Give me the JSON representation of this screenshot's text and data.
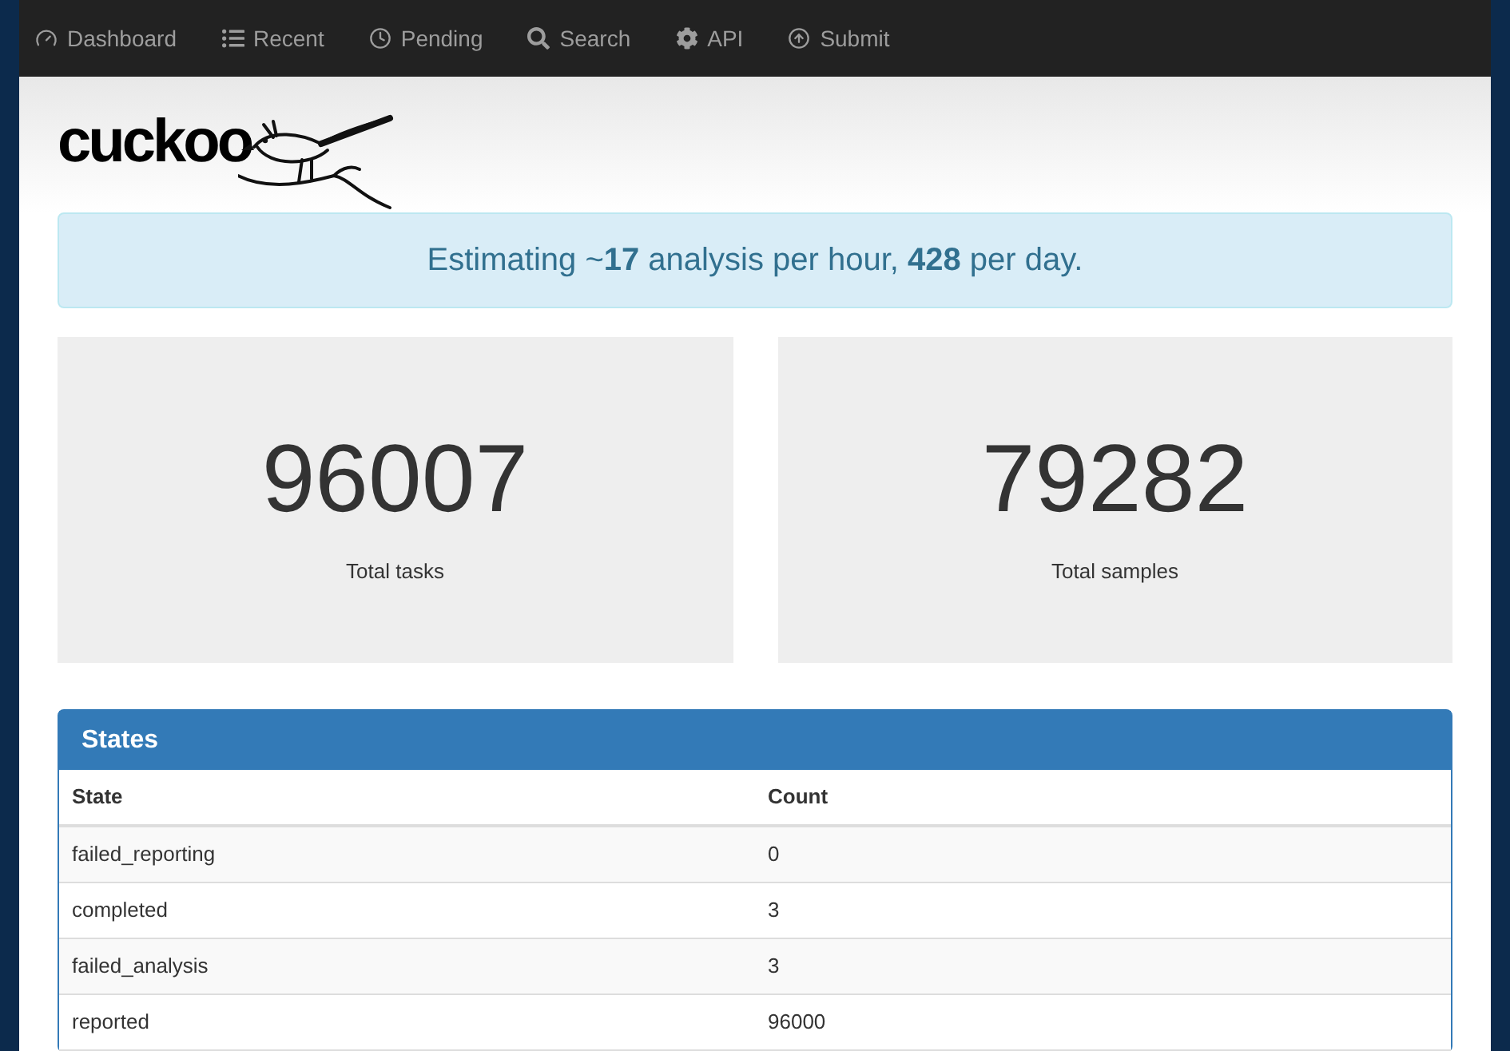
{
  "nav": [
    {
      "kind": "dashboard",
      "label": "Dashboard"
    },
    {
      "kind": "list",
      "label": "Recent"
    },
    {
      "kind": "clock",
      "label": "Pending"
    },
    {
      "kind": "search",
      "label": "Search"
    },
    {
      "kind": "gear",
      "label": "API"
    },
    {
      "kind": "upload",
      "label": "Submit"
    }
  ],
  "logo": {
    "text": "cuckoo"
  },
  "alert": "Estimating ~**17** analysis per hour, **428** per day.",
  "stats": [
    {
      "value": "96007",
      "label": "Total tasks"
    },
    {
      "value": "79282",
      "label": "Total samples"
    }
  ],
  "states_panel": {
    "title": "States",
    "columns": [
      "State",
      "Count"
    ],
    "rows": [
      [
        "failed_reporting",
        "0"
      ],
      [
        "completed",
        "3"
      ],
      [
        "failed_analysis",
        "3"
      ],
      [
        "reported",
        "96000"
      ]
    ]
  }
}
